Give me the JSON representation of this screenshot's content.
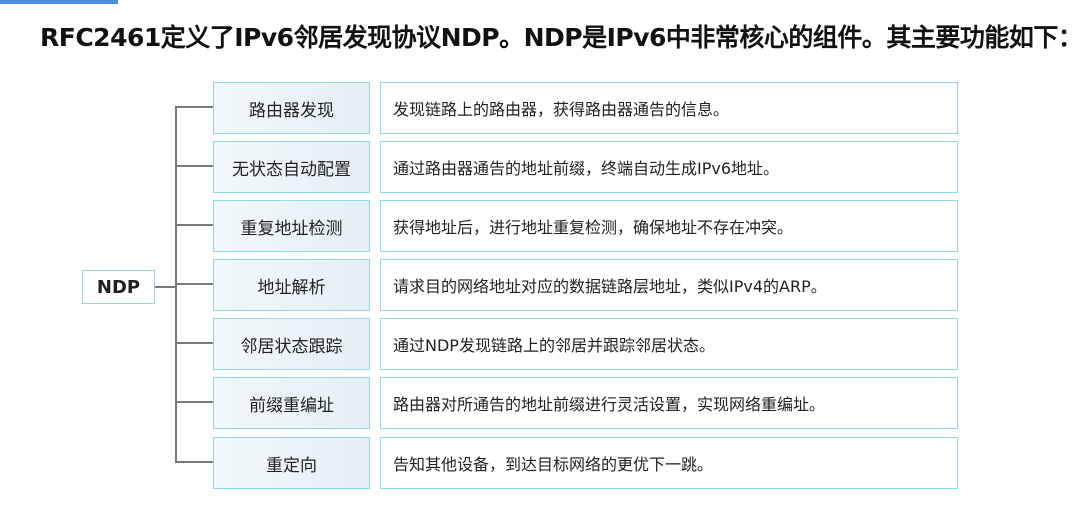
{
  "title": "RFC2461定义了IPv6邻居发现协议NDP。NDP是IPv6中非常核心的组件。其主要功能如下：",
  "root": "NDP",
  "items": [
    {
      "label": "路由器发现",
      "description": "发现链路上的路由器，获得路由器通告的信息。"
    },
    {
      "label": "无状态自动配置",
      "description": "通过路由器通告的地址前缀，终端自动生成IPv6地址。"
    },
    {
      "label": "重复地址检测",
      "description": "获得地址后，进行地址重复检测，确保地址不存在冲突。"
    },
    {
      "label": "地址解析",
      "description": "请求目的网络地址对应的数据链路层地址，类似IPv4的ARP。"
    },
    {
      "label": "邻居状态跟踪",
      "description": "通过NDP发现链路上的邻居并跟踪邻居状态。"
    },
    {
      "label": "前缀重编址",
      "description": "路由器对所通告的地址前缀进行灵活设置，实现网络重编址。"
    },
    {
      "label": "重定向",
      "description": "告知其他设备，到达目标网络的更优下一跳。"
    }
  ]
}
